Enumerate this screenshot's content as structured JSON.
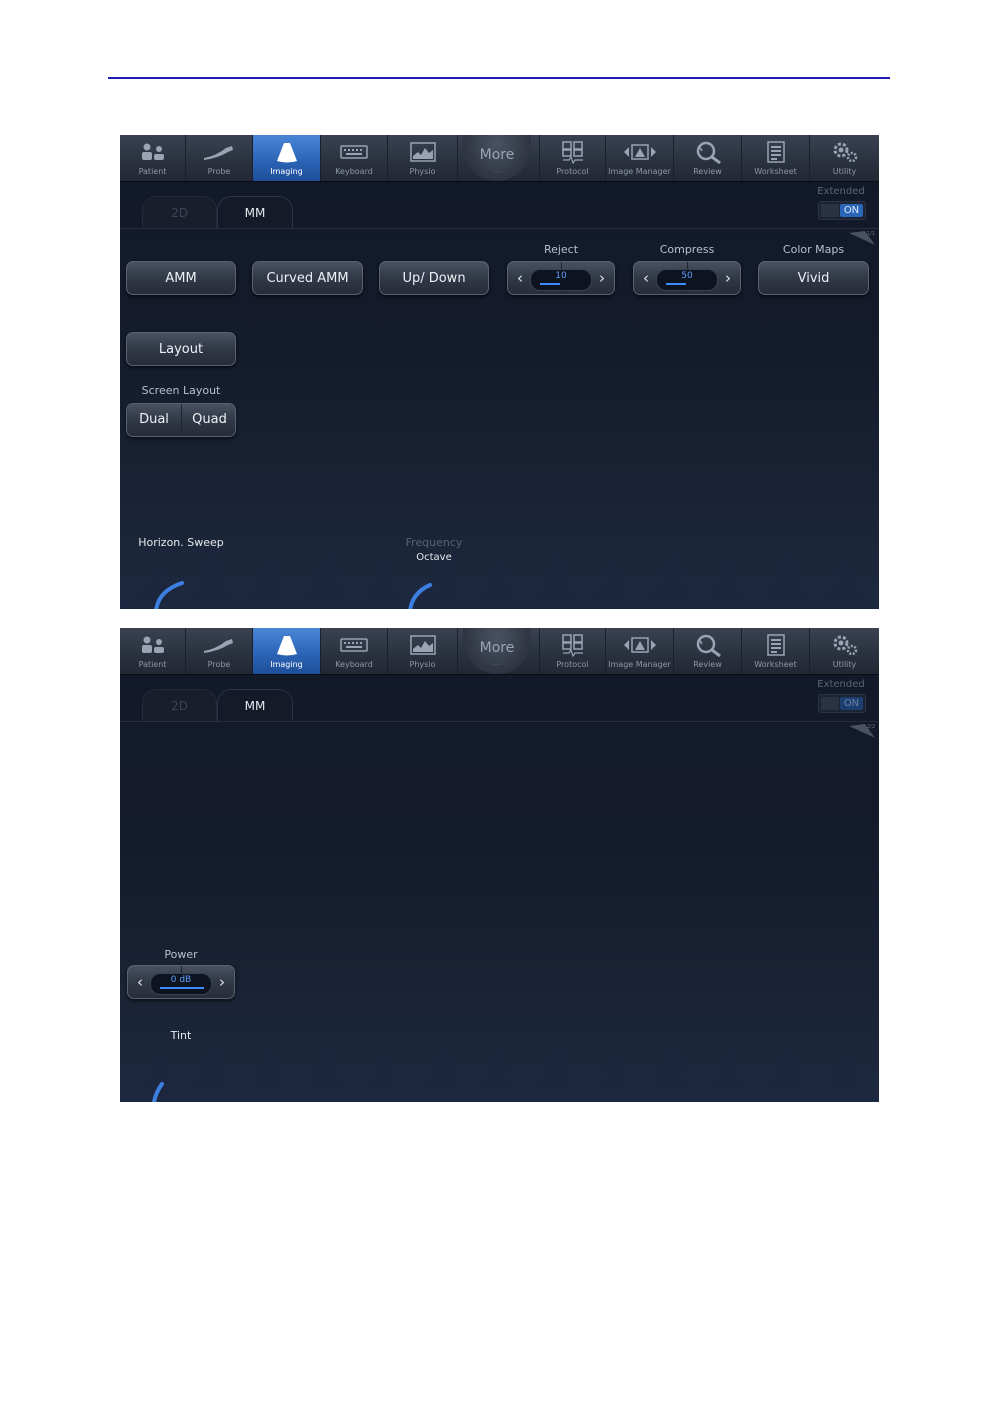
{
  "toolbar": {
    "items": [
      {
        "label": "Patient",
        "icon": "patient-icon"
      },
      {
        "label": "Probe",
        "icon": "probe-icon"
      },
      {
        "label": "Imaging",
        "icon": "imaging-icon",
        "active": true
      },
      {
        "label": "Keyboard",
        "icon": "keyboard-icon"
      },
      {
        "label": "Physio",
        "icon": "physio-icon"
      },
      {
        "label": "Protocol",
        "icon": "protocol-icon"
      },
      {
        "label": "Image Manager",
        "icon": "image-manager-icon"
      },
      {
        "label": "Review",
        "icon": "review-icon"
      },
      {
        "label": "Worksheet",
        "icon": "worksheet-icon"
      },
      {
        "label": "Utility",
        "icon": "utility-icon"
      }
    ],
    "more_label": "More",
    "active_color": "#2a62b4"
  },
  "tabs": {
    "tab_2d": "2D",
    "tab_mm": "MM"
  },
  "extended": {
    "label": "Extended",
    "state": "ON"
  },
  "screen1": {
    "amm_label": "AMM",
    "curved_amm_label": "Curved AMM",
    "updown_label": "Up/ Down",
    "reject": {
      "label": "Reject",
      "value": "10"
    },
    "compress": {
      "label": "Compress",
      "value": "50"
    },
    "color_maps": {
      "label": "Color Maps",
      "value": "Vivid"
    },
    "layout_label": "Layout",
    "screen_layout": {
      "label": "Screen Layout",
      "dual": "Dual",
      "quad": "Quad"
    },
    "knob_horizon": "Horizon. Sweep",
    "knob_frequency": "Frequency",
    "knob_frequency_value": "Octave"
  },
  "screen2": {
    "power": {
      "label": "Power",
      "value": "0 dB"
    },
    "knob_tint": "Tint"
  },
  "colors": {
    "accent": "#3d8cff",
    "background": "#141b2b",
    "rule": "#1c1cb0"
  }
}
